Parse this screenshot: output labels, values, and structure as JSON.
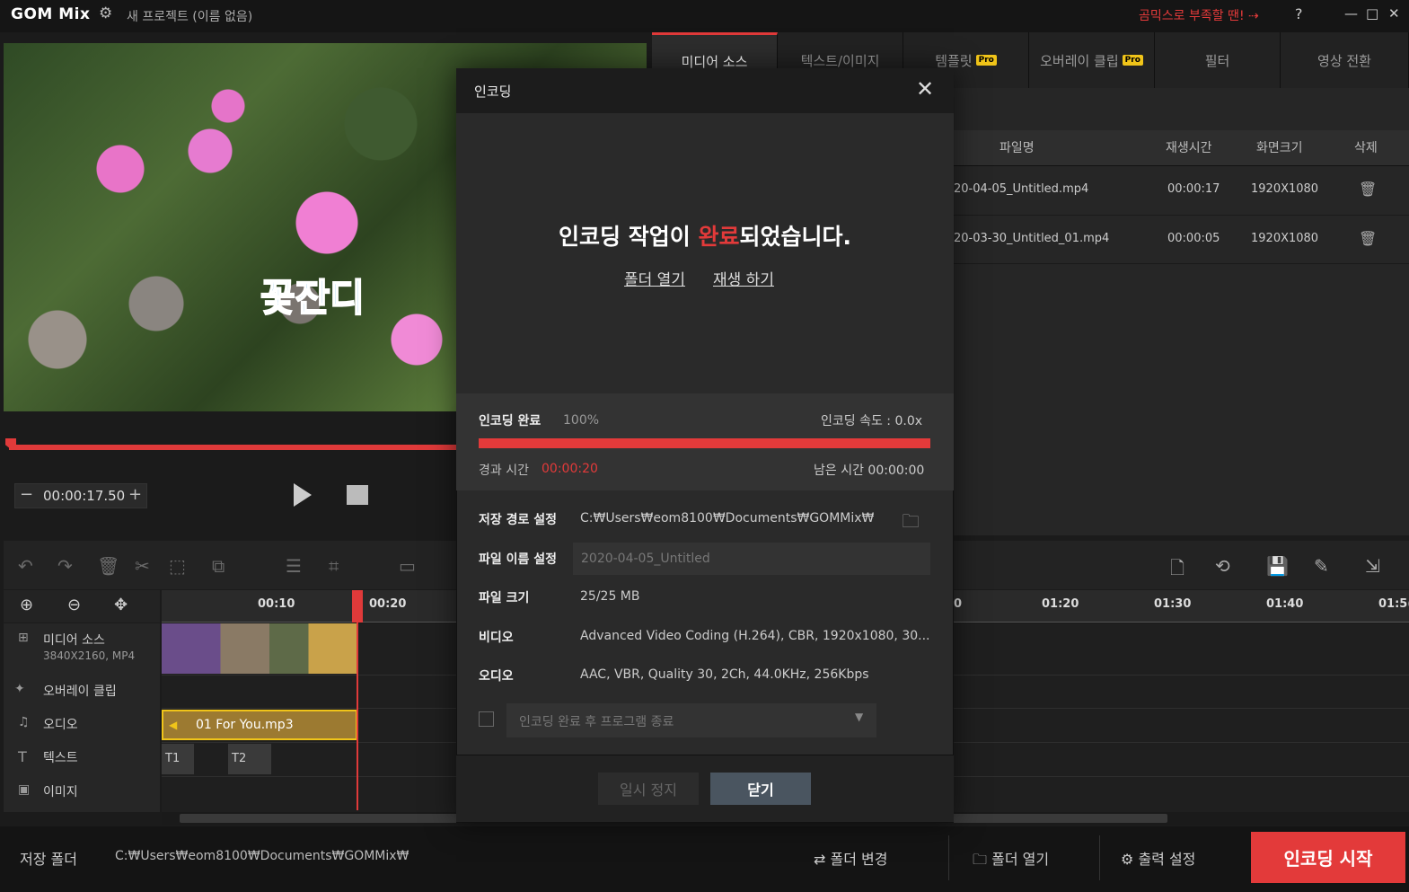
{
  "titlebar": {
    "logo": "GOM Mix",
    "project": "새 프로젝트 (이름 없음)",
    "promo": "곰믹스로 부족할 땐! ⇢",
    "help": "?"
  },
  "preview": {
    "caption": "꽃잔디",
    "time": "00:00:17.50"
  },
  "tabs": [
    {
      "label": "미디어 소스",
      "pro": false
    },
    {
      "label": "텍스트/이미지",
      "pro": false
    },
    {
      "label": "템플릿",
      "pro": true
    },
    {
      "label": "오버레이 클립",
      "pro": true
    },
    {
      "label": "필터",
      "pro": false
    },
    {
      "label": "영상 전환",
      "pro": false
    }
  ],
  "pro_badge": "Pro",
  "media_table": {
    "headers": [
      "파일명",
      "재생시간",
      "화면크기",
      "삭제"
    ],
    "rows": [
      {
        "name": "20-04-05_Untitled.mp4",
        "duration": "00:00:17",
        "size": "1920X1080"
      },
      {
        "name": "20-03-30_Untitled_01.mp4",
        "duration": "00:00:05",
        "size": "1920X1080"
      }
    ]
  },
  "timeline": {
    "ticks_left": [
      "00:10",
      "00:20"
    ],
    "ticks_right": [
      "0",
      "01:20",
      "01:30",
      "01:40",
      "01:5("
    ],
    "tracks": [
      {
        "label": "미디어 소스",
        "sub": "3840X2160, MP4"
      },
      {
        "label": "오버레이 클립"
      },
      {
        "label": "오디오"
      },
      {
        "label": "텍스트"
      },
      {
        "label": "이미지"
      }
    ],
    "audio_clip": "01 For You.mp3",
    "text_clips": [
      "T1",
      "T2"
    ]
  },
  "bottombar": {
    "save_folder_label": "저장 폴더",
    "save_folder_path": "C:₩Users₩eom8100₩Documents₩GOMMix₩",
    "change_folder": "폴더 변경",
    "open_folder": "폴더 열기",
    "output_settings": "출력 설정",
    "encode_start": "인코딩 시작"
  },
  "dialog": {
    "title": "인코딩",
    "message_pre": "인코딩 작업이 ",
    "message_accent": "완료",
    "message_post": "되었습니다.",
    "link_open_folder": "폴더 열기",
    "link_play": "재생 하기",
    "progress_label": "인코딩 완료",
    "progress_pct": "100%",
    "progress_fraction": 1.0,
    "speed": "인코딩 속도 : 0.0x",
    "elapsed_label": "경과 시간",
    "elapsed_value": "00:00:20",
    "remaining": "남은 시간 00:00:00",
    "save_path_label": "저장 경로 설정",
    "save_path_value": "C:₩Users₩eom8100₩Documents₩GOMMix₩",
    "filename_label": "파일 이름 설정",
    "filename_value": "2020-04-05_Untitled",
    "filesize_label": "파일 크기",
    "filesize_value": "25/25 MB",
    "video_label": "비디오",
    "video_value": "Advanced Video Coding (H.264), CBR, 1920x1080, 30...",
    "audio_label": "오디오",
    "audio_value": "AAC, VBR, Quality 30, 2Ch, 44.0KHz, 256Kbps",
    "after_encode_option": "인코딩 완료 후 프로그램 종료",
    "pause_button": "일시 정지",
    "close_button": "닫기"
  },
  "colors": {
    "accent": "#e33a3a",
    "pro_badge": "#f0c419",
    "caption": "#1d8bd6"
  }
}
